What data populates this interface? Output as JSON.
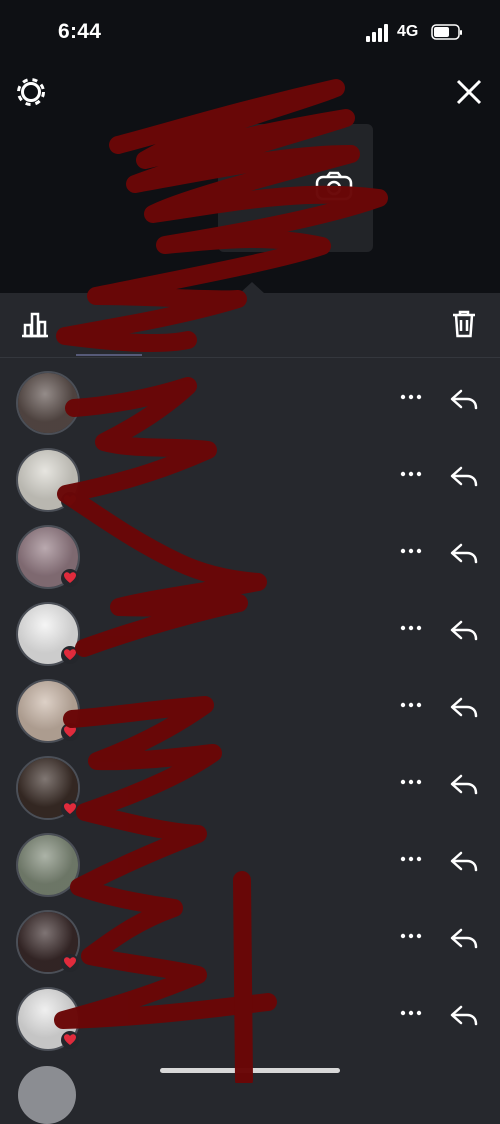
{
  "status_bar": {
    "time": "6:44",
    "network": "4G"
  },
  "viewers": [
    {
      "avatar": "#5b4e4a",
      "liked": false
    },
    {
      "avatar": "#d9d7cf",
      "liked": true
    },
    {
      "avatar": "#947b84",
      "liked": true
    },
    {
      "avatar": "#f0f0f0",
      "liked": true
    },
    {
      "avatar": "#cab7a8",
      "liked": true
    },
    {
      "avatar": "#3c2e28",
      "liked": true
    },
    {
      "avatar": "#7f8a78",
      "liked": false
    },
    {
      "avatar": "#3a2a2a",
      "liked": true
    },
    {
      "avatar": "#e7e7e7",
      "liked": true
    }
  ],
  "colors": {
    "scribble": "#6a0707",
    "heart": "#e02b3c"
  }
}
